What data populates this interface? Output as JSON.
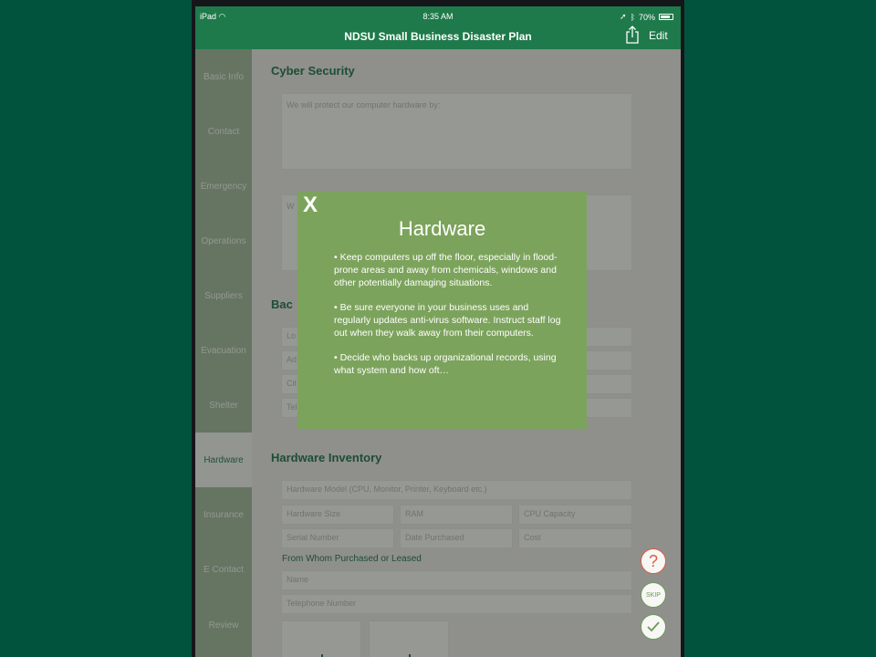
{
  "status_bar": {
    "device": "iPad",
    "time": "8:35 AM",
    "battery": "70%"
  },
  "nav": {
    "title": "NDSU Small Business Disaster Plan",
    "edit_label": "Edit"
  },
  "sidebar": {
    "items": [
      {
        "label": "Basic Info"
      },
      {
        "label": "Contact"
      },
      {
        "label": "Emergency"
      },
      {
        "label": "Operations"
      },
      {
        "label": "Suppliers"
      },
      {
        "label": "Evacuation"
      },
      {
        "label": "Shelter"
      },
      {
        "label": "Hardware",
        "active": true
      },
      {
        "label": "Insurance"
      },
      {
        "label": "E Contact"
      },
      {
        "label": "Review"
      }
    ]
  },
  "content": {
    "cyber_heading": "Cyber Security",
    "protect_placeholder": "We will protect our computer hardware by:",
    "second_placeholder": "W",
    "backup_heading_partial": "Bac",
    "backup_fields": [
      "Lo",
      "Ad",
      "Cit",
      "Tele"
    ],
    "inventory_heading": "Hardware Inventory",
    "inventory_fields": {
      "model": "Hardware Model (CPU, Monitor, Printer, Keyboard etc.)",
      "size": "Hardware Size",
      "ram": "RAM",
      "cpu": "CPU Capacity",
      "serial": "Serial Number",
      "date": "Date Purchased",
      "cost": "Cost"
    },
    "purchased_label": "From Whom Purchased or Leased",
    "name_placeholder": "Name",
    "phone_placeholder": "Telephone Number"
  },
  "actions": {
    "help": "?",
    "skip": "SKIP"
  },
  "popup": {
    "close": "X",
    "title": "Hardware",
    "bullets": [
      "• Keep computers up off the floor, especially in flood-prone areas and away from chemicals, windows and other potentially damaging situations.",
      "• Be sure everyone in your business uses and regularly updates anti-virus software. Instruct staff log out when they walk away from their computers.",
      "• Decide who backs up organizational records, using what system and how oft…"
    ]
  },
  "colors": {
    "brand_green": "#1f7a4b",
    "sidebar_green": "#9eb99a",
    "popup_green": "#7ca35c",
    "help_red": "#e35a3c"
  }
}
